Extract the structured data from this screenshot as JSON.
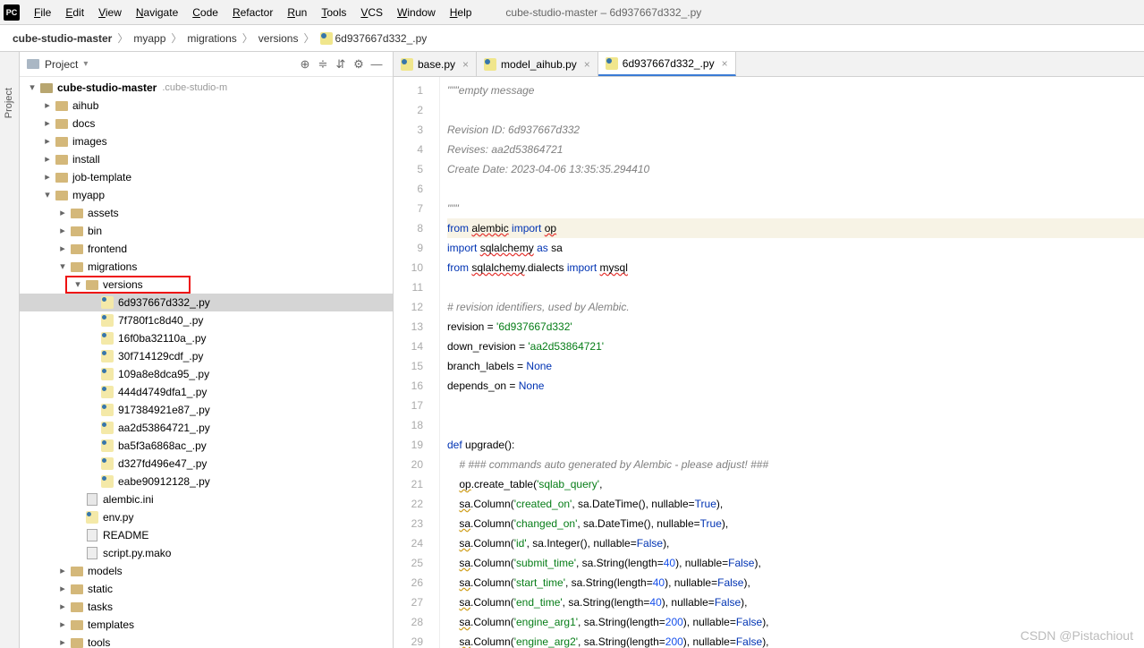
{
  "window_title": "cube-studio-master – 6d937667d332_.py",
  "menus": [
    "File",
    "Edit",
    "View",
    "Navigate",
    "Code",
    "Refactor",
    "Run",
    "Tools",
    "VCS",
    "Window",
    "Help"
  ],
  "breadcrumb": [
    "cube-studio-master",
    "myapp",
    "migrations",
    "versions",
    "6d937667d332_.py"
  ],
  "project_panel": {
    "title": "Project"
  },
  "tree": {
    "root": {
      "label": "cube-studio-master",
      "extra": ".cube-studio-m"
    },
    "l1": [
      "aihub",
      "docs",
      "images",
      "install",
      "job-template"
    ],
    "myapp": "myapp",
    "myapp_children": [
      "assets",
      "bin",
      "frontend"
    ],
    "migrations": "migrations",
    "versions": "versions",
    "version_files": [
      "6d937667d332_.py",
      "7f780f1c8d40_.py",
      "16f0ba32110a_.py",
      "30f714129cdf_.py",
      "109a8e8dca95_.py",
      "444d4749dfa1_.py",
      "917384921e87_.py",
      "aa2d53864721_.py",
      "ba5f3a6868ac_.py",
      "d327fd496e47_.py",
      "eabe90912128_.py"
    ],
    "mig_other": [
      {
        "name": "alembic.ini",
        "type": "ini"
      },
      {
        "name": "env.py",
        "type": "py"
      },
      {
        "name": "README",
        "type": "txt"
      },
      {
        "name": "script.py.mako",
        "type": "txt"
      }
    ],
    "myapp_tail": [
      "models",
      "static",
      "tasks",
      "templates",
      "tools"
    ]
  },
  "tabs": [
    {
      "label": "base.py",
      "active": false
    },
    {
      "label": "model_aihub.py",
      "active": false
    },
    {
      "label": "6d937667d332_.py",
      "active": true
    }
  ],
  "code_lines": [
    {
      "n": 1,
      "html": "<span class='c-comment'>\"\"\"empty message</span>"
    },
    {
      "n": 2,
      "html": ""
    },
    {
      "n": 3,
      "html": "<span class='c-comment'>Revision ID: 6d937667d332</span>"
    },
    {
      "n": 4,
      "html": "<span class='c-comment'>Revises: aa2d53864721</span>"
    },
    {
      "n": 5,
      "html": "<span class='c-comment'>Create Date: 2023-04-06 13:35:35.294410</span>"
    },
    {
      "n": 6,
      "html": ""
    },
    {
      "n": 7,
      "html": "<span class='c-comment'>\"\"\"</span>"
    },
    {
      "n": 8,
      "hl": true,
      "html": "<span class='c-kw'>from</span> <span class='c-err'>alembic</span> <span class='c-kw'>import</span> <span class='c-err'>op</span>"
    },
    {
      "n": 9,
      "html": "<span class='c-kw'>import</span> <span class='c-err'>sqlalchemy</span> <span class='c-kw'>as</span> sa"
    },
    {
      "n": 10,
      "html": "<span class='c-kw'>from</span> <span class='c-err'>sqlalchemy</span>.dialects <span class='c-kw'>import</span> <span class='c-err'>mysql</span>"
    },
    {
      "n": 11,
      "html": ""
    },
    {
      "n": 12,
      "html": "<span class='c-comment'># revision identifiers, used by Alembic.</span>"
    },
    {
      "n": 13,
      "html": "revision = <span class='c-str'>'6d937667d332'</span>"
    },
    {
      "n": 14,
      "html": "down_revision = <span class='c-str'>'aa2d53864721'</span>"
    },
    {
      "n": 15,
      "html": "branch_labels = <span class='c-none'>None</span>"
    },
    {
      "n": 16,
      "html": "depends_on = <span class='c-none'>None</span>"
    },
    {
      "n": 17,
      "html": ""
    },
    {
      "n": 18,
      "html": ""
    },
    {
      "n": 19,
      "html": "<span class='c-kw'>def</span> upgrade():"
    },
    {
      "n": 20,
      "html": "    <span class='c-comment'># ### commands auto generated by Alembic - please adjust! ###</span>"
    },
    {
      "n": 21,
      "html": "    <span class='c-warn'>op</span>.create_table(<span class='c-str'>'sqlab_query'</span>,"
    },
    {
      "n": 22,
      "html": "    <span class='c-warn'>sa</span>.Column(<span class='c-str'>'created_on'</span>, sa.DateTime(), nullable=<span class='c-none'>True</span>),"
    },
    {
      "n": 23,
      "html": "    <span class='c-warn'>sa</span>.Column(<span class='c-str'>'changed_on'</span>, sa.DateTime(), nullable=<span class='c-none'>True</span>),"
    },
    {
      "n": 24,
      "html": "    <span class='c-warn'>sa</span>.Column(<span class='c-str'>'id'</span>, sa.Integer(), nullable=<span class='c-none'>False</span>),"
    },
    {
      "n": 25,
      "html": "    <span class='c-warn'>sa</span>.Column(<span class='c-str'>'submit_time'</span>, sa.String(length=<span class='c-num'>40</span>), nullable=<span class='c-none'>False</span>),"
    },
    {
      "n": 26,
      "html": "    <span class='c-warn'>sa</span>.Column(<span class='c-str'>'start_time'</span>, sa.String(length=<span class='c-num'>40</span>), nullable=<span class='c-none'>False</span>),"
    },
    {
      "n": 27,
      "html": "    <span class='c-warn'>sa</span>.Column(<span class='c-str'>'end_time'</span>, sa.String(length=<span class='c-num'>40</span>), nullable=<span class='c-none'>False</span>),"
    },
    {
      "n": 28,
      "html": "    <span class='c-warn'>sa</span>.Column(<span class='c-str'>'engine_arg1'</span>, sa.String(length=<span class='c-num'>200</span>), nullable=<span class='c-none'>False</span>),"
    },
    {
      "n": 29,
      "html": "    <span class='c-warn'>sa</span>.Column(<span class='c-str'>'engine_arg2'</span>, sa.String(length=<span class='c-num'>200</span>), nullable=<span class='c-none'>False</span>),"
    }
  ],
  "watermark": "CSDN @Pistachiout"
}
